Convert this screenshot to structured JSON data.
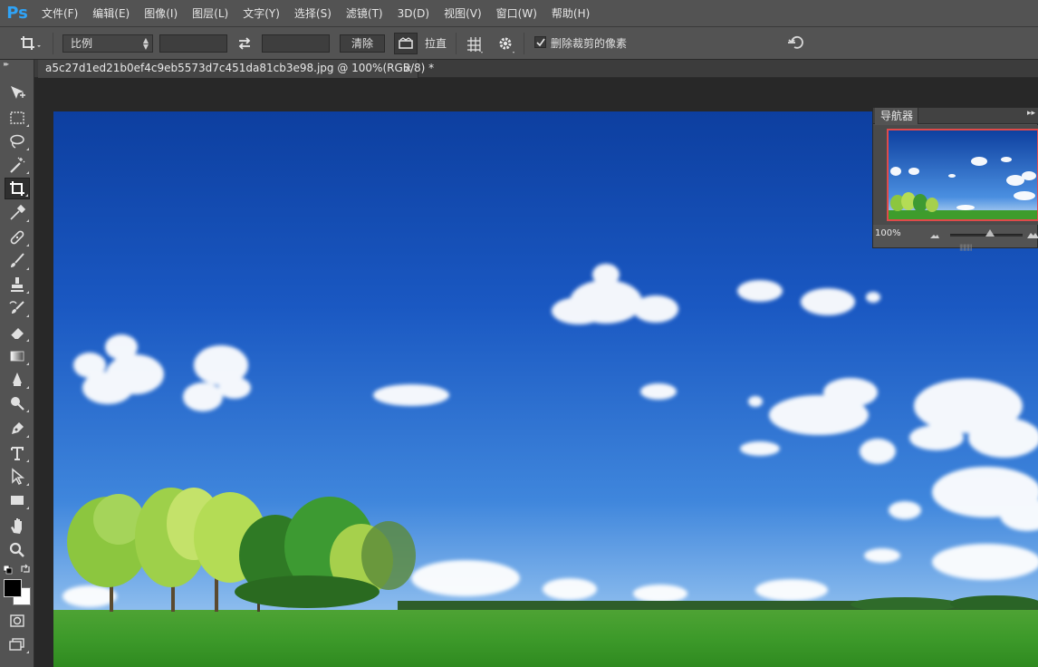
{
  "app": {
    "logo": "Ps",
    "menu": [
      "文件(F)",
      "编辑(E)",
      "图像(I)",
      "图层(L)",
      "文字(Y)",
      "选择(S)",
      "滤镜(T)",
      "3D(D)",
      "视图(V)",
      "窗口(W)",
      "帮助(H)"
    ]
  },
  "options_bar": {
    "tool_icon": "crop-icon",
    "preset_value": "比例",
    "width_value": "",
    "height_value": "",
    "swap_icon": "swap-arrows-icon",
    "clear_label": "清除",
    "straighten_label": "拉直",
    "grid_icon": "grid-overlay-icon",
    "settings_icon": "gear-icon",
    "delete_cropped_label": "删除裁剪的像素",
    "delete_cropped_checked": true,
    "reset_icon": "reset-icon"
  },
  "tools": [
    {
      "name": "move-tool",
      "icon": "move-icon"
    },
    {
      "name": "marquee-tool",
      "icon": "rect-marquee-icon"
    },
    {
      "name": "lasso-tool",
      "icon": "lasso-icon"
    },
    {
      "name": "magic-wand-tool",
      "icon": "magic-wand-icon"
    },
    {
      "name": "crop-tool",
      "icon": "crop-icon",
      "active": true
    },
    {
      "name": "eyedropper-tool",
      "icon": "eyedropper-icon"
    },
    {
      "name": "healing-brush-tool",
      "icon": "bandage-icon"
    },
    {
      "name": "brush-tool",
      "icon": "brush-icon"
    },
    {
      "name": "clone-stamp-tool",
      "icon": "stamp-icon"
    },
    {
      "name": "history-brush-tool",
      "icon": "history-brush-icon"
    },
    {
      "name": "eraser-tool",
      "icon": "eraser-icon"
    },
    {
      "name": "gradient-tool",
      "icon": "gradient-icon"
    },
    {
      "name": "blur-tool",
      "icon": "blur-icon"
    },
    {
      "name": "dodge-tool",
      "icon": "dodge-icon"
    },
    {
      "name": "pen-tool",
      "icon": "pen-icon"
    },
    {
      "name": "type-tool",
      "icon": "type-icon"
    },
    {
      "name": "path-selection-tool",
      "icon": "arrow-select-icon"
    },
    {
      "name": "shape-tool",
      "icon": "rectangle-icon"
    },
    {
      "name": "hand-tool",
      "icon": "hand-icon"
    },
    {
      "name": "zoom-tool",
      "icon": "zoom-icon"
    }
  ],
  "colors": {
    "foreground": "#000000",
    "background": "#ffffff"
  },
  "document": {
    "tab_title": "a5c27d1ed21b0ef4c9eb5573d7c451da81cb3e98.jpg @ 100%(RGB/8) *",
    "close": "×"
  },
  "navigator": {
    "title": "导航器",
    "zoom": "100%",
    "collapse": "▸▸",
    "zoom_level": 0.55
  }
}
